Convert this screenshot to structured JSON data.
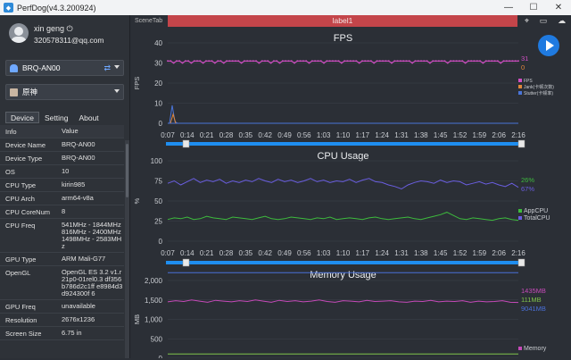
{
  "window": {
    "title": "PerfDog(v4.3.200924)"
  },
  "user": {
    "name": "xin geng",
    "email": "320578311@qq.com"
  },
  "device_select": {
    "value": "BRQ-AN00"
  },
  "app_select": {
    "value": "原神"
  },
  "tabs": [
    "Device",
    "Setting",
    "About"
  ],
  "info_table": {
    "headers": [
      "Info",
      "Value"
    ],
    "rows": [
      {
        "k": "Device Name",
        "v": "BRQ-AN00"
      },
      {
        "k": "Device Type",
        "v": "BRQ-AN00"
      },
      {
        "k": "OS",
        "v": "10"
      },
      {
        "k": "CPU Type",
        "v": "kirin985"
      },
      {
        "k": "CPU Arch",
        "v": "arm64-v8a"
      },
      {
        "k": "CPU CoreNum",
        "v": "8"
      },
      {
        "k": "CPU Freq",
        "v": "541MHz - 1844MHz 816MHz - 2400MHz 1498MHz - 2583MHz"
      },
      {
        "k": "GPU Type",
        "v": "ARM Mali-G77"
      },
      {
        "k": "OpenGL",
        "v": "OpenGL ES 3.2 v1.r21p0-01rel0.3 df356b786d2c1ff e8984d3d924300f 6"
      },
      {
        "k": "GPU Freq",
        "v": "unavailable"
      },
      {
        "k": "Resolution",
        "v": "2676x1236"
      },
      {
        "k": "Screen Size",
        "v": "6.75 in"
      }
    ]
  },
  "scene_tab": "SceneTab",
  "label_bar": "label1",
  "time_ticks": [
    "0:07",
    "0:14",
    "0:21",
    "0:28",
    "0:35",
    "0:42",
    "0:49",
    "0:56",
    "1:03",
    "1:10",
    "1:17",
    "1:24",
    "1:31",
    "1:38",
    "1:45",
    "1:52",
    "1:59",
    "2:06",
    "2:16"
  ],
  "colors": {
    "fps": "#d14fc4",
    "jank": "#e0873a",
    "stutter": "#4a74d8",
    "appcpu": "#3dbb3d",
    "totalcpu": "#6a5ee0",
    "memory": "#c64ab9",
    "swap": "#7fc34a",
    "virtual": "#4a70d8",
    "accent": "#1f7ae0",
    "label": "#c4454a"
  },
  "chart_data": [
    {
      "type": "line",
      "title": "FPS",
      "ylabel": "FPS",
      "ylim": [
        0,
        40
      ],
      "yticks": [
        "40",
        "30",
        "20",
        "10",
        "0"
      ],
      "series": [
        {
          "name": "FPS",
          "current": "31",
          "values": [
            31,
            31,
            30,
            31,
            31,
            30,
            31,
            31,
            30,
            31,
            31,
            31,
            30,
            31,
            31,
            31,
            30,
            31,
            31,
            30,
            31,
            31,
            31,
            31,
            31,
            30,
            31,
            31,
            31,
            31,
            31,
            30,
            31,
            31,
            31,
            30,
            31,
            31,
            30,
            31,
            31,
            31,
            31,
            30,
            31,
            31,
            31,
            31,
            30,
            31,
            31,
            31,
            31,
            30,
            31,
            31,
            31,
            31,
            31,
            30,
            31,
            31,
            31,
            31,
            31,
            30,
            31,
            31,
            31,
            31,
            30,
            31,
            31,
            31,
            31,
            31,
            30,
            31,
            31,
            31,
            31,
            31,
            31,
            30,
            31,
            31,
            31,
            31,
            31,
            30,
            31,
            31,
            31,
            31,
            31,
            30,
            31,
            31,
            31,
            31,
            31,
            30,
            31,
            31,
            31,
            31,
            31,
            30,
            31,
            31,
            31,
            31,
            31,
            30,
            31,
            31,
            31,
            31,
            31,
            31
          ]
        },
        {
          "name": "Jank(卡顿次数)",
          "current": "0",
          "values": [
            0,
            0,
            0,
            0,
            0,
            0,
            0,
            0,
            0,
            0
          ]
        },
        {
          "name": "Stutter(卡顿率)",
          "current": "",
          "values": [
            0,
            0,
            0,
            0,
            0,
            0,
            0,
            0,
            0,
            0
          ]
        }
      ]
    },
    {
      "type": "line",
      "title": "CPU Usage",
      "ylabel": "%",
      "ylim": [
        0,
        100
      ],
      "yticks": [
        "100",
        "75",
        "50",
        "25",
        "0"
      ],
      "series": [
        {
          "name": "AppCPU",
          "current": "26%",
          "values": [
            27,
            29,
            28,
            30,
            27,
            28,
            31,
            29,
            28,
            27,
            30,
            29,
            28,
            27,
            29,
            31,
            28,
            27,
            28,
            30,
            29,
            28,
            27,
            29,
            28,
            30,
            27,
            28,
            29,
            28,
            27,
            29,
            30,
            28,
            27,
            28,
            29,
            30,
            28,
            27,
            29,
            31,
            33,
            36,
            32,
            28,
            27,
            29,
            28,
            27,
            26,
            28,
            29,
            27,
            26
          ]
        },
        {
          "name": "TotalCPU",
          "current": "67%",
          "values": [
            72,
            75,
            70,
            74,
            78,
            73,
            76,
            74,
            77,
            72,
            75,
            73,
            76,
            74,
            78,
            75,
            73,
            77,
            74,
            76,
            73,
            75,
            78,
            74,
            76,
            73,
            75,
            74,
            77,
            73,
            76,
            78,
            74,
            73,
            70,
            68,
            65,
            70,
            73,
            75,
            74,
            72,
            76,
            73,
            75,
            74,
            70,
            72,
            74,
            71,
            73,
            70,
            68,
            72,
            67
          ]
        }
      ]
    },
    {
      "type": "line",
      "title": "Memory Usage",
      "ylabel": "MB",
      "ylim": [
        0,
        2000
      ],
      "yticks": [
        "2,000",
        "1,500",
        "1,000",
        "500",
        "0"
      ],
      "series": [
        {
          "name": "Memory",
          "current": "1435MB",
          "values": [
            1450,
            1480,
            1460,
            1500,
            1470,
            1440,
            1490,
            1470,
            1450,
            1480,
            1460,
            1500,
            1470,
            1440,
            1490,
            1460,
            1480,
            1450,
            1470,
            1500,
            1460,
            1440,
            1480,
            1470,
            1450,
            1490,
            1460,
            1470,
            1480,
            1450,
            1440,
            1470,
            1460,
            1490,
            1450,
            1470,
            1460,
            1480,
            1440,
            1470,
            1450,
            1460,
            1480,
            1440,
            1435
          ]
        },
        {
          "name": "SwapMemory",
          "current": "111MB",
          "values": [
            111,
            111,
            111,
            111,
            111,
            111,
            111,
            111,
            111,
            111
          ]
        },
        {
          "name": "VirtualMemory",
          "current": "9041MB",
          "values": [
            9041,
            9041,
            9041
          ]
        }
      ]
    }
  ]
}
